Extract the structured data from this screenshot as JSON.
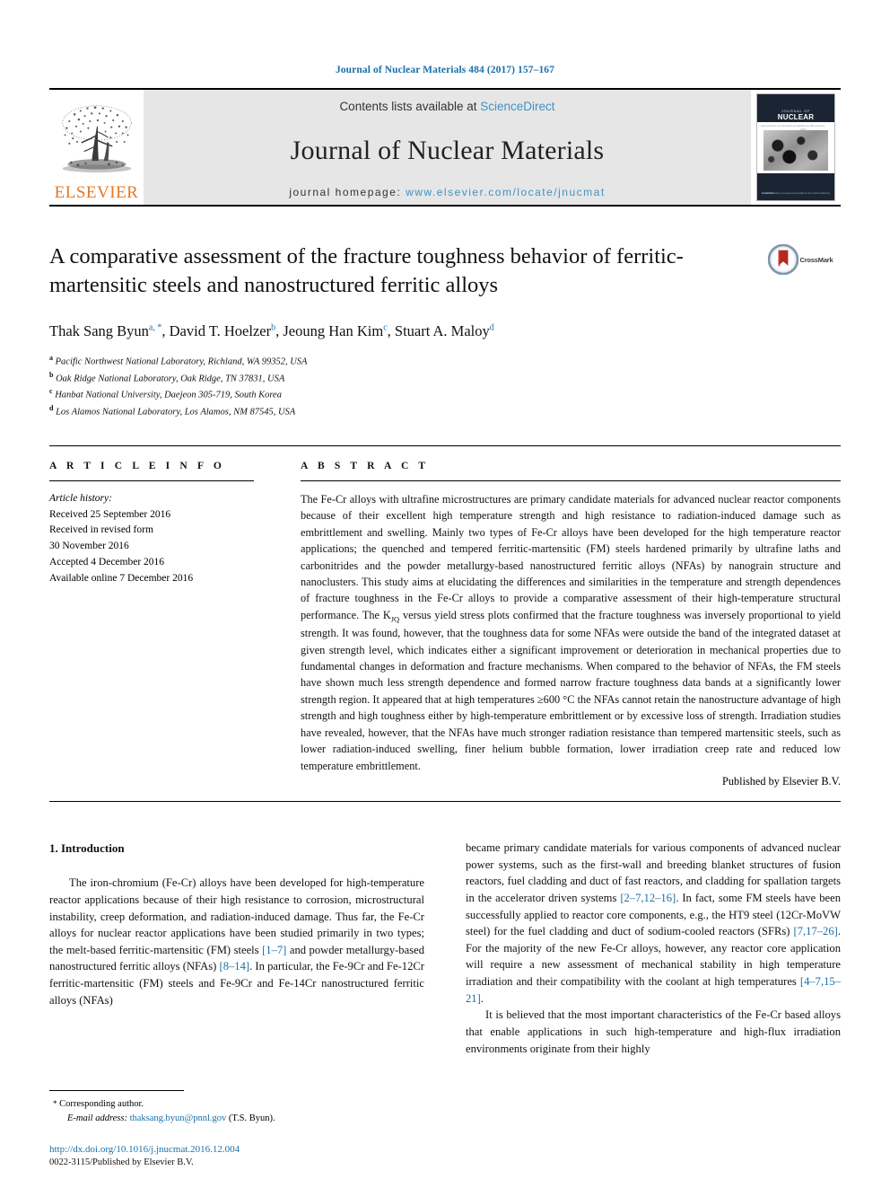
{
  "running_head": "Journal of Nuclear Materials 484 (2017) 157–167",
  "masthead": {
    "contents_prefix": "Contents lists available at ",
    "sciencedirect": "ScienceDirect",
    "journal_name": "Journal of Nuclear Materials",
    "homepage_label": "journal homepage: ",
    "homepage_url": "www.elsevier.com/locate/jnucmat",
    "publisher_wordmark": "ELSEVIER",
    "cover": {
      "small_title": "JOURNAL OF",
      "main_title": "NUCLEAR MATERIALS",
      "sub_left": "www.elsevier.com/locate/jnucmat",
      "sub_right": "Volume 484  January 2017",
      "bottom_left": "ELSEVIER",
      "bottom_right": "Available online at\nwww.sciencedirect.com\nScienceDirect"
    },
    "link_color": "#3e93c6",
    "band_color": "#e6e6e6"
  },
  "title_block": {
    "title": "A comparative assessment of the fracture toughness behavior of ferritic-martensitic steels and nanostructured ferritic alloys",
    "authors": [
      {
        "name": "Thak Sang Byun",
        "marks": "a, *"
      },
      {
        "name": "David T. Hoelzer",
        "marks": "b"
      },
      {
        "name": "Jeoung Han Kim",
        "marks": "c"
      },
      {
        "name": "Stuart A. Maloy",
        "marks": "d"
      }
    ],
    "affiliations": [
      {
        "mark": "a",
        "text": "Pacific Northwest National Laboratory, Richland, WA 99352, USA"
      },
      {
        "mark": "b",
        "text": "Oak Ridge National Laboratory, Oak Ridge, TN 37831, USA"
      },
      {
        "mark": "c",
        "text": "Hanbat National University, Daejeon 305-719, South Korea"
      },
      {
        "mark": "d",
        "text": "Los Alamos National Laboratory, Los Alamos, NM 87545, USA"
      }
    ],
    "crossmark_label": "CrossMark"
  },
  "article_info": {
    "label": "A R T I C L E   I N F O",
    "history_title": "Article history:",
    "history": [
      "Received 25 September 2016",
      "Received in revised form",
      "30 November 2016",
      "Accepted 4 December 2016",
      "Available online 7 December 2016"
    ]
  },
  "abstract": {
    "label": "A B S T R A C T",
    "part1": "The Fe-Cr alloys with ultrafine microstructures are primary candidate materials for advanced nuclear reactor components because of their excellent high temperature strength and high resistance to radiation-induced damage such as embrittlement and swelling. Mainly two types of Fe-Cr alloys have been developed for the high temperature reactor applications; the quenched and tempered ferritic-martensitic (FM) steels hardened primarily by ultrafine laths and carbonitrides and the powder metallurgy-based nanostructured ferritic alloys (NFAs) by nanograin structure and nanoclusters. This study aims at elucidating the differences and similarities in the temperature and strength dependences of fracture toughness in the Fe-Cr alloys to provide a comparative assessment of their high-temperature structural performance. The K",
    "sub1": "JQ",
    "part2": " versus yield stress plots confirmed that the fracture toughness was inversely proportional to yield strength. It was found, however, that the toughness data for some NFAs were outside the band of the integrated dataset at given strength level, which indicates either a significant improvement or deterioration in mechanical properties due to fundamental changes in deformation and fracture mechanisms. When compared to the behavior of NFAs, the FM steels have shown much less strength dependence and formed narrow fracture toughness data bands at a significantly lower strength region. It appeared that at high temperatures ≥600 °C the NFAs cannot retain the nanostructure advantage of high strength and high toughness either by high-temperature embrittlement or by excessive loss of strength. Irradiation studies have revealed, however, that the NFAs have much stronger radiation resistance than tempered martensitic steels, such as lower radiation-induced swelling, finer helium bubble formation, lower irradiation creep rate and reduced low temperature embrittlement.",
    "published_by": "Published by Elsevier B.V."
  },
  "body": {
    "section_heading": "1.  Introduction",
    "left_paragraph_1_a": "The iron-chromium (Fe-Cr) alloys have been developed for high-temperature reactor applications because of their high resistance to corrosion, microstructural instability, creep deformation, and radiation-induced damage. Thus far, the Fe-Cr alloys for nuclear reactor applications have been studied primarily in two types; the melt-based ferritic-martensitic (FM) steels ",
    "left_ref_1": "[1–7]",
    "left_paragraph_1_b": " and powder metallurgy-based nanostructured ferritic alloys (NFAs) ",
    "left_ref_2": "[8–14]",
    "left_paragraph_1_c": ". In particular, the Fe-9Cr and Fe-12Cr ferritic-martensitic (FM) steels and Fe-9Cr and Fe-14Cr nanostructured ferritic alloys (NFAs)",
    "right_paragraph_1_a": "became primary candidate materials for various components of advanced nuclear power systems, such as the first-wall and breeding blanket structures of fusion reactors, fuel cladding and duct of fast reactors, and cladding for spallation targets in the accelerator driven systems ",
    "right_ref_1": "[2–7,12–16]",
    "right_paragraph_1_b": ". In fact, some FM steels have been successfully applied to reactor core components, e.g., the HT9 steel (12Cr-MoVW steel) for the fuel cladding and duct of sodium-cooled reactors (SFRs) ",
    "right_ref_2": "[7,17–26]",
    "right_paragraph_1_c": ". For the majority of the new Fe-Cr alloys, however, any reactor core application will require a new assessment of mechanical stability in high temperature irradiation and their compatibility with the coolant at high temperatures ",
    "right_ref_3": "[4–7,15–21]",
    "right_paragraph_1_d": ".",
    "right_paragraph_2": "It is believed that the most important characteristics of the Fe-Cr based alloys that enable applications in such high-temperature and high-flux irradiation environments originate from their highly"
  },
  "footnotes": {
    "corresponding_marker": "*",
    "corresponding_text": "Corresponding author.",
    "email_label": "E-mail address:",
    "email_link": "thaksang.byun@pnnl.gov",
    "email_suffix": " (T.S. Byun).",
    "doi": "http://dx.doi.org/10.1016/j.jnucmat.2016.12.004",
    "issn": "0022-3115/Published by Elsevier B.V."
  }
}
